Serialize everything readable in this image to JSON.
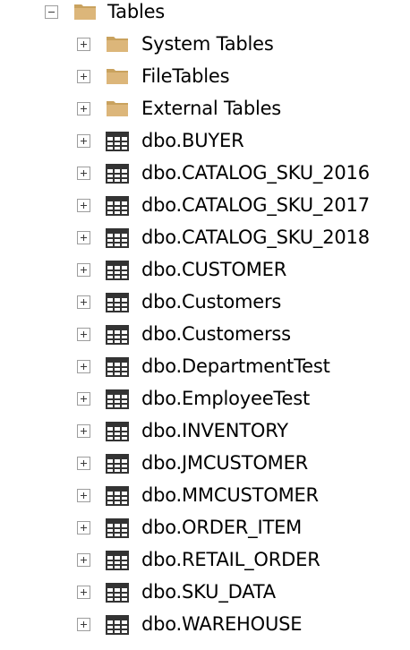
{
  "tree": {
    "root": {
      "label": "Tables",
      "icon": "folder-icon",
      "expanded": true
    },
    "folders": [
      {
        "label": "System Tables",
        "icon": "folder-icon"
      },
      {
        "label": "FileTables",
        "icon": "folder-icon"
      },
      {
        "label": "External Tables",
        "icon": "folder-icon"
      }
    ],
    "tables": [
      {
        "label": "dbo.BUYER",
        "icon": "table-icon"
      },
      {
        "label": "dbo.CATALOG_SKU_2016",
        "icon": "table-icon"
      },
      {
        "label": "dbo.CATALOG_SKU_2017",
        "icon": "table-icon"
      },
      {
        "label": "dbo.CATALOG_SKU_2018",
        "icon": "table-icon"
      },
      {
        "label": "dbo.CUSTOMER",
        "icon": "table-icon"
      },
      {
        "label": "dbo.Customers",
        "icon": "table-icon"
      },
      {
        "label": "dbo.Customerss",
        "icon": "table-icon"
      },
      {
        "label": "dbo.DepartmentTest",
        "icon": "table-icon"
      },
      {
        "label": "dbo.EmployeeTest",
        "icon": "table-icon"
      },
      {
        "label": "dbo.INVENTORY",
        "icon": "table-icon"
      },
      {
        "label": "dbo.JMCUSTOMER",
        "icon": "table-icon"
      },
      {
        "label": "dbo.MMCUSTOMER",
        "icon": "table-icon"
      },
      {
        "label": "dbo.ORDER_ITEM",
        "icon": "table-icon"
      },
      {
        "label": "dbo.RETAIL_ORDER",
        "icon": "table-icon"
      },
      {
        "label": "dbo.SKU_DATA",
        "icon": "table-icon"
      },
      {
        "label": "dbo.WAREHOUSE",
        "icon": "table-icon"
      }
    ]
  },
  "colors": {
    "folder": "#dcb67a",
    "folder_dark": "#c9a25e",
    "table_icon": "#333333",
    "expander_border": "#9d9d9d"
  }
}
